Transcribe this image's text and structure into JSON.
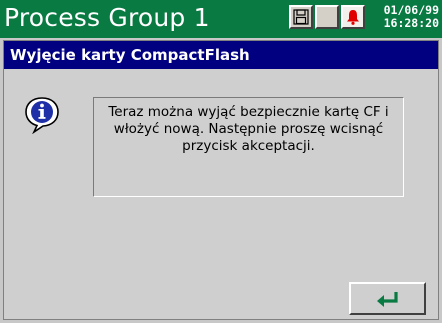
{
  "header": {
    "title": "Process Group 1",
    "date": "01/06/99",
    "time": "16:28:20",
    "icons": [
      "disk-icon",
      "blank-status-icon",
      "alarm-bell-icon"
    ],
    "colors": {
      "background": "#0a7a43",
      "text": "#ffffff",
      "alarm": "#e00000"
    }
  },
  "dialog": {
    "title": "Wyjęcie karty CompactFlash",
    "icon": "info-icon",
    "message": "Teraz można wyjąć bezpiecznie kartę CF i włożyć nową. Następnie proszę wcisnąć przycisk akceptacji.",
    "accept_icon": "enter-arrow-icon",
    "colors": {
      "header": "#000080",
      "body": "#cfcfcf",
      "accept_arrow": "#0a7a43"
    }
  }
}
